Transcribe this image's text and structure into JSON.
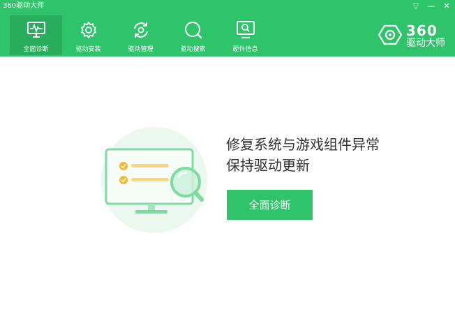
{
  "app": {
    "title": "360驱动大师"
  },
  "window_controls": {
    "menu": "▽",
    "minimize": "—",
    "close": "✕"
  },
  "nav": {
    "items": [
      {
        "label": "全面诊断",
        "icon": "monitor-pulse-icon"
      },
      {
        "label": "驱动安装",
        "icon": "gear-icon"
      },
      {
        "label": "驱动管理",
        "icon": "refresh-gear-icon"
      },
      {
        "label": "驱动搜索",
        "icon": "search-icon"
      },
      {
        "label": "硬件信息",
        "icon": "monitor-search-icon"
      }
    ]
  },
  "brand": {
    "num": "360",
    "name": "驱动大师",
    "icon": "360-logo-icon"
  },
  "main": {
    "headline_line1": "修复系统与游戏组件异常",
    "headline_line2": "保持驱动更新",
    "cta_label": "全面诊断",
    "illustration": "monitor-check-magnifier-illustration"
  },
  "colors": {
    "accent": "#2fc469",
    "active_tab": "#27ad5b",
    "text": "#333333"
  }
}
